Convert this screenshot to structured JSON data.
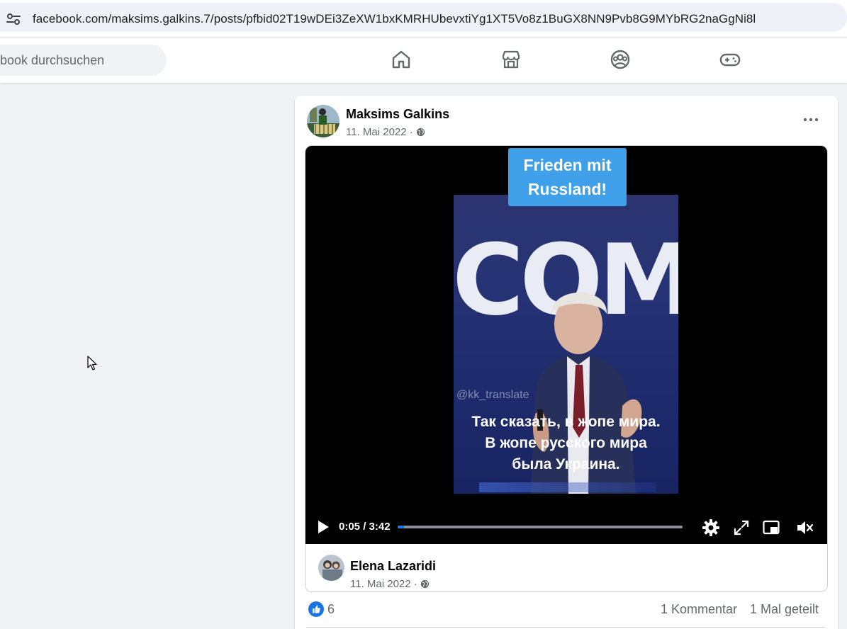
{
  "browser": {
    "url": "facebook.com/maksims.galkins.7/posts/pfbid02T19wDEi3ZeXW1bxKMRHUbevxtiYg1XT5Vo8z1BuGX8NN9Pvb8G9MYbRG2naGgNi8l",
    "site_info_icon": "site-settings-icon"
  },
  "nav": {
    "search_text": "book durchsuchen",
    "icons": [
      "home-icon",
      "marketplace-icon",
      "groups-icon",
      "gaming-icon"
    ]
  },
  "post": {
    "author": "Maksims Galkins",
    "date": "11. Mai 2022 ·",
    "privacy_icon": "globe-icon",
    "more_icon": "more-options-icon"
  },
  "video": {
    "caption_line1": "Frieden mit",
    "caption_line2": "Russland!",
    "backdrop_text": "COMP",
    "watermark": "@kk_translate",
    "subtitle_line1": "Так сказать, в жопе мира.",
    "subtitle_line2": "В жопе русского мира",
    "subtitle_line3": "была Украина.",
    "current_time": "0:05",
    "duration": "3:42",
    "time_display": "0:05 / 3:42",
    "progress_fraction": 0.023,
    "controls": [
      "play-icon",
      "settings-gear-icon",
      "fullscreen-icon",
      "picture-in-picture-icon",
      "muted-speaker-icon"
    ]
  },
  "shared_post": {
    "author": "Elena Lazaridi",
    "date": "11. Mai 2022 ·"
  },
  "reactions": {
    "like_count": "6",
    "comments": "1 Kommentar",
    "shares": "1 Mal geteilt"
  },
  "colors": {
    "fb_blue": "#1b74e4",
    "caption_blue": "#3f9fe8",
    "page_bg": "#f0f2f5"
  }
}
